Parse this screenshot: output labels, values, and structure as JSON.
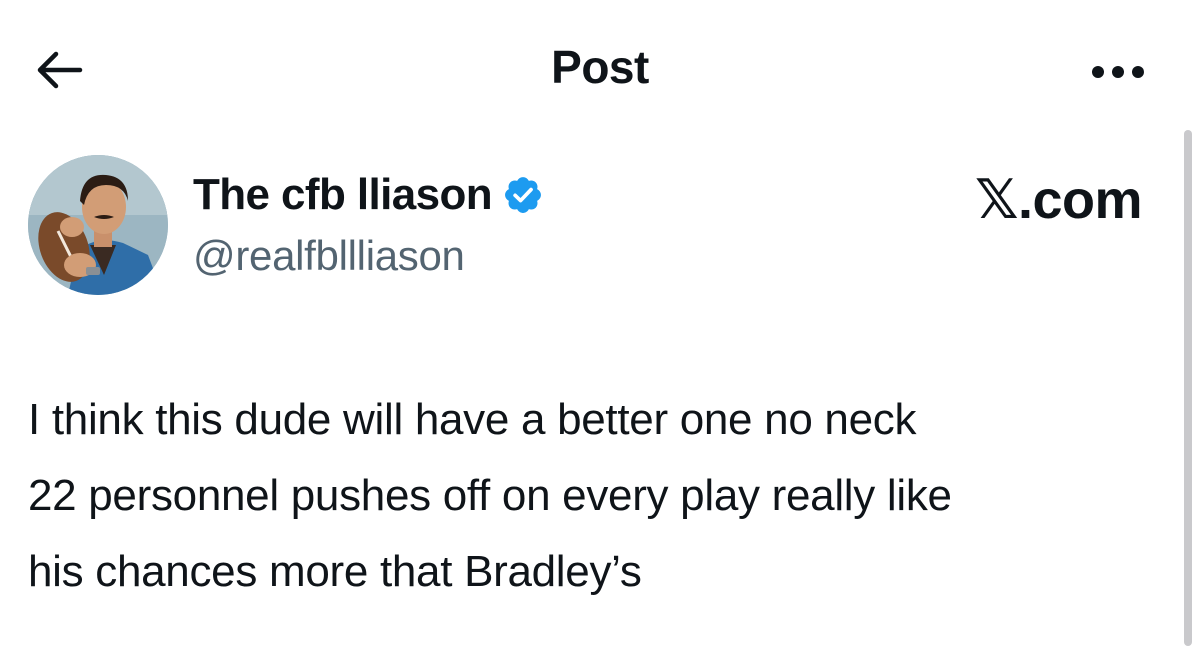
{
  "header": {
    "title": "Post"
  },
  "author": {
    "display_name": "The cfb lliason",
    "handle": "@realfbllliason",
    "verified": true
  },
  "source_mark": "𝕏.com",
  "post": {
    "lines": [
      "I think this dude will have a better one no neck",
      "22 personnel pushes off on every play really like",
      "his chances more that Bradley’s"
    ]
  },
  "colors": {
    "text_primary": "#0f1419",
    "text_secondary": "#536471",
    "verified_blue": "#1d9bf0",
    "scrollbar": "#c9c9cc"
  },
  "icons": {
    "back": "arrow-left-icon",
    "more": "more-horizontal-icon",
    "verified": "verified-badge-icon"
  }
}
